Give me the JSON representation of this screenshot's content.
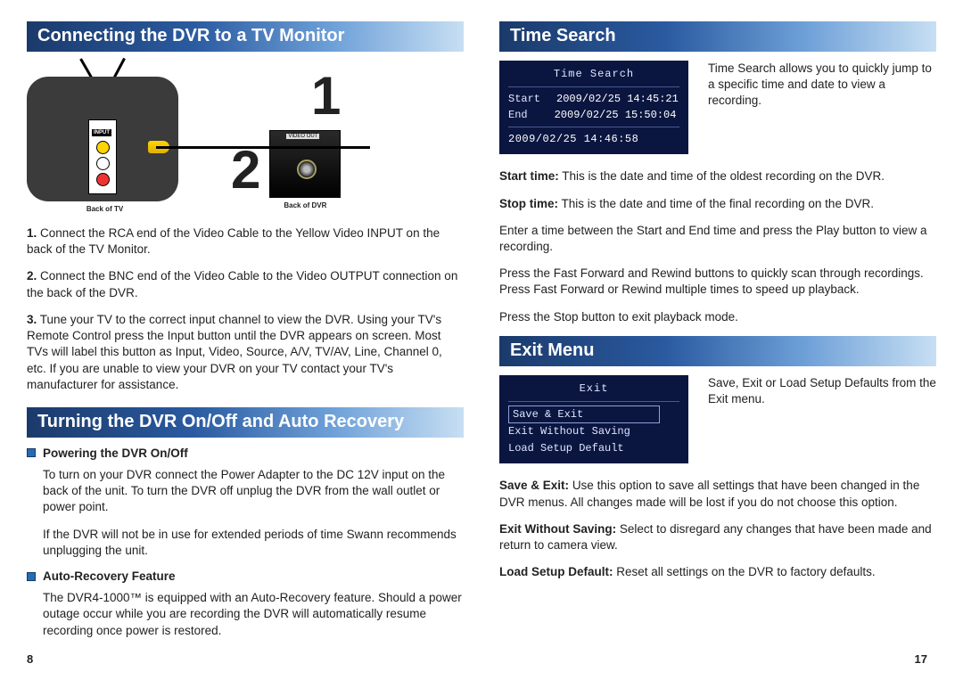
{
  "left": {
    "header1": "Connecting the DVR to a TV Monitor",
    "diagram": {
      "num1": "1",
      "num2": "2",
      "input_label": "INPUT",
      "video_out_label": "VIDEO OUT",
      "back_tv": "Back of TV",
      "back_dvr": "Back of DVR"
    },
    "steps": {
      "s1_label": "1.",
      "s1": "Connect the RCA end of the Video Cable to the Yellow Video INPUT on the back of the TV Monitor.",
      "s2_label": "2.",
      "s2": "Connect the BNC end of the Video Cable to the Video OUTPUT connection on the back of the DVR.",
      "s3_label": "3.",
      "s3": "Tune your TV to the correct input channel to view the DVR.  Using your TV's Remote Control press the Input button until the DVR appears on screen.  Most TVs will label this button as Input, Video, Source, A/V, TV/AV, Line, Channel 0, etc.  If you are unable to view your DVR on your TV contact your TV's manufacturer for assistance."
    },
    "header2": "Turning the DVR On/Off and Auto Recovery",
    "powering_label": "Powering the DVR On/Off",
    "auto_label": "Auto-Recovery Feature",
    "power_p1": "To turn on your DVR connect the Power Adapter to the DC 12V input on the back of the unit.  To turn the DVR off unplug the DVR from the wall outlet or power point.",
    "power_p2": "If the DVR will not be in use for extended periods of time Swann recommends unplugging the unit.",
    "auto_p1": "The DVR4-1000™ is equipped with an Auto-Recovery feature.  Should a power outage occur while you are recording the DVR will automatically resume recording once power is restored.",
    "page_num": "8"
  },
  "right": {
    "header1": "Time Search",
    "ts_menu": {
      "title": "Time Search",
      "start_lbl": "Start",
      "start_val": "2009/02/25 14:45:21",
      "end_lbl": "End",
      "end_val": "2009/02/25 15:50:04",
      "cursor": "2009/02/25 14:46:58"
    },
    "ts_intro": "Time Search allows you to quickly jump to a specific time and date to view a recording.",
    "start_label": "Start time:",
    "start_text": "This is the date and time of the oldest recording on the DVR.",
    "stop_label": "Stop time:",
    "stop_text": "This is the date and time of the final recording on the DVR.",
    "ts_p3": "Enter a time between the Start and End time and press the Play button to view a recording.",
    "ts_p4": "Press the Fast Forward and Rewind buttons to quickly scan through recordings.  Press Fast Forward or Rewind multiple times to speed up playback.",
    "ts_p5": "Press the Stop button to exit playback mode.",
    "header2": "Exit Menu",
    "exit_menu": {
      "title": "Exit",
      "opt1": "Save & Exit",
      "opt2": "Exit Without Saving",
      "opt3": "Load Setup Default"
    },
    "exit_intro": "Save, Exit or Load Setup Defaults from the Exit menu.",
    "se_label": "Save & Exit:",
    "se_text": "Use this option to save all settings that have been changed in the DVR menus.  All changes made will be lost if you do not choose this option.",
    "ews_label": "Exit Without Saving:",
    "ews_text": "Select to disregard any changes that have been made and return to camera view.",
    "lsd_label": "Load Setup Default:",
    "lsd_text": "Reset all settings on the DVR to factory defaults.",
    "page_num": "17"
  }
}
